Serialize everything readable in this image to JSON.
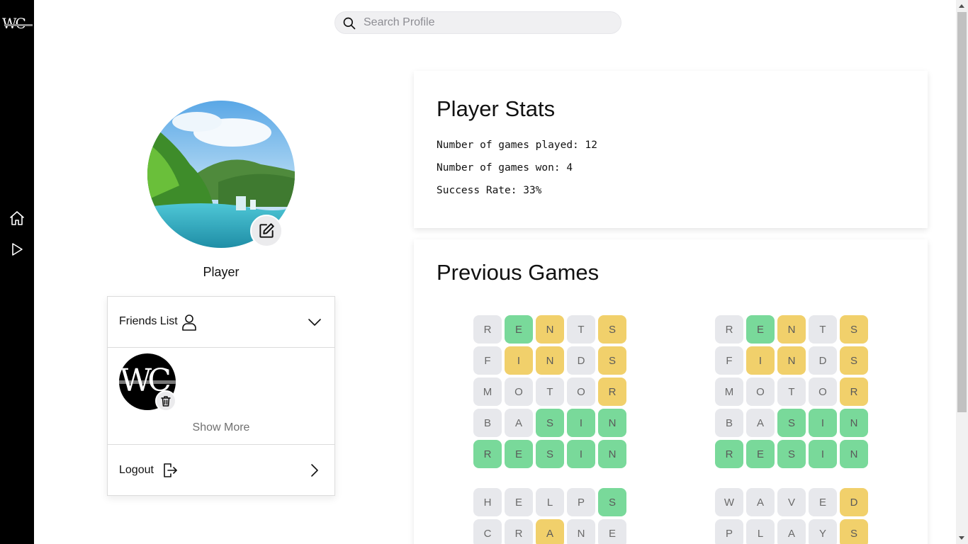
{
  "app": {
    "logo_text": "WC"
  },
  "sidebar": {
    "items": [
      {
        "icon": "home-icon"
      },
      {
        "icon": "play-icon"
      }
    ]
  },
  "search": {
    "placeholder": "Search Profile",
    "value": ""
  },
  "profile": {
    "name": "Player",
    "friends_label": "Friends List",
    "friend_avatar_text": "WC",
    "show_more": "Show More",
    "logout_label": "Logout"
  },
  "stats": {
    "title": "Player Stats",
    "games_played": "Number of games played: 12",
    "games_won": "Number of games won: 4",
    "success_rate": "Success Rate: 33%"
  },
  "previous_games": {
    "title": "Previous Games",
    "games": [
      {
        "rows": [
          [
            [
              "R",
              "gray"
            ],
            [
              "E",
              "green"
            ],
            [
              "N",
              "yellow"
            ],
            [
              "T",
              "gray"
            ],
            [
              "S",
              "yellow"
            ]
          ],
          [
            [
              "F",
              "gray"
            ],
            [
              "I",
              "yellow"
            ],
            [
              "N",
              "yellow"
            ],
            [
              "D",
              "gray"
            ],
            [
              "S",
              "yellow"
            ]
          ],
          [
            [
              "M",
              "gray"
            ],
            [
              "O",
              "gray"
            ],
            [
              "T",
              "gray"
            ],
            [
              "O",
              "gray"
            ],
            [
              "R",
              "yellow"
            ]
          ],
          [
            [
              "B",
              "gray"
            ],
            [
              "A",
              "gray"
            ],
            [
              "S",
              "green"
            ],
            [
              "I",
              "green"
            ],
            [
              "N",
              "green"
            ]
          ],
          [
            [
              "R",
              "green"
            ],
            [
              "E",
              "green"
            ],
            [
              "S",
              "green"
            ],
            [
              "I",
              "green"
            ],
            [
              "N",
              "green"
            ]
          ]
        ]
      },
      {
        "rows": [
          [
            [
              "R",
              "gray"
            ],
            [
              "E",
              "green"
            ],
            [
              "N",
              "yellow"
            ],
            [
              "T",
              "gray"
            ],
            [
              "S",
              "yellow"
            ]
          ],
          [
            [
              "F",
              "gray"
            ],
            [
              "I",
              "yellow"
            ],
            [
              "N",
              "yellow"
            ],
            [
              "D",
              "gray"
            ],
            [
              "S",
              "yellow"
            ]
          ],
          [
            [
              "M",
              "gray"
            ],
            [
              "O",
              "gray"
            ],
            [
              "T",
              "gray"
            ],
            [
              "O",
              "gray"
            ],
            [
              "R",
              "yellow"
            ]
          ],
          [
            [
              "B",
              "gray"
            ],
            [
              "A",
              "gray"
            ],
            [
              "S",
              "green"
            ],
            [
              "I",
              "green"
            ],
            [
              "N",
              "green"
            ]
          ],
          [
            [
              "R",
              "green"
            ],
            [
              "E",
              "green"
            ],
            [
              "S",
              "green"
            ],
            [
              "I",
              "green"
            ],
            [
              "N",
              "green"
            ]
          ]
        ]
      },
      {
        "rows": [
          [
            [
              "H",
              "gray"
            ],
            [
              "E",
              "gray"
            ],
            [
              "L",
              "gray"
            ],
            [
              "P",
              "gray"
            ],
            [
              "S",
              "green"
            ]
          ],
          [
            [
              "C",
              "gray"
            ],
            [
              "R",
              "gray"
            ],
            [
              "A",
              "yellow"
            ],
            [
              "N",
              "gray"
            ],
            [
              "E",
              "gray"
            ]
          ]
        ]
      },
      {
        "rows": [
          [
            [
              "W",
              "gray"
            ],
            [
              "A",
              "gray"
            ],
            [
              "V",
              "gray"
            ],
            [
              "E",
              "gray"
            ],
            [
              "D",
              "yellow"
            ]
          ],
          [
            [
              "P",
              "gray"
            ],
            [
              "L",
              "gray"
            ],
            [
              "A",
              "gray"
            ],
            [
              "Y",
              "gray"
            ],
            [
              "S",
              "yellow"
            ]
          ]
        ]
      }
    ]
  },
  "colors": {
    "green": "#79d99a",
    "yellow": "#f1d06b",
    "gray": "#e7e8ec",
    "sidebar": "#000000"
  }
}
